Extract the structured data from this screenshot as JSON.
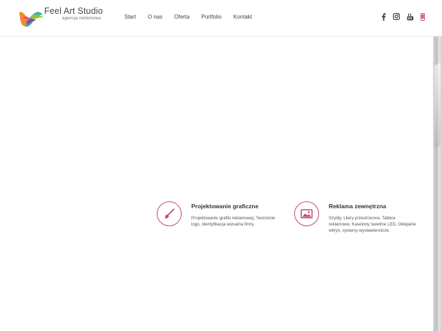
{
  "brand": {
    "name": "Feel Art Studio",
    "tagline": "agencja reklamowa"
  },
  "nav": {
    "items": [
      {
        "label": "Start"
      },
      {
        "label": "O nas"
      },
      {
        "label": "Oferta"
      },
      {
        "label": "Portfolio"
      },
      {
        "label": "Kontakt"
      }
    ]
  },
  "social": {
    "icons": [
      "facebook-icon",
      "instagram-icon",
      "youtube-icon",
      "phone-icon"
    ]
  },
  "colors": {
    "accent": "#c3476e",
    "text": "#333333"
  },
  "features": [
    {
      "title": "Projektowanie graficzne",
      "description": "Projektowanie grafiki reklamowej, Tworzenie logo, Identyfikacja wizualna firmy.",
      "icon": "paintbrush-icon"
    },
    {
      "title": "Reklama zewnętrzna",
      "description": "Szyldy, Litery przestrzenne, Tablice reklamowe, Kasetony świetlne LED, Oklejanie witryn, systemy wystawiennicze.",
      "icon": "image-icon"
    }
  ]
}
